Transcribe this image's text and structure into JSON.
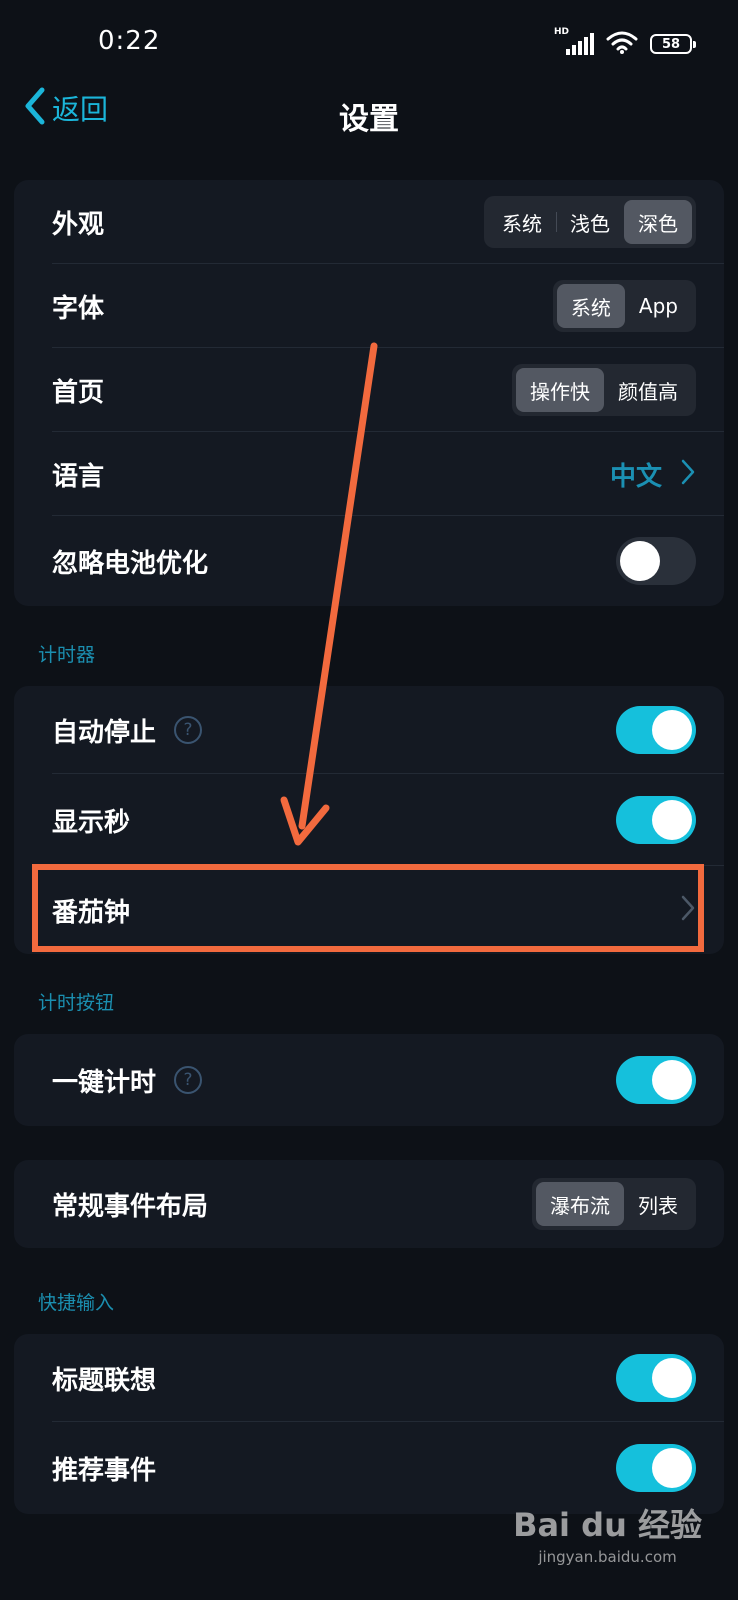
{
  "status_bar": {
    "time": "0:22",
    "network_badge": "HD",
    "battery_level": "58"
  },
  "header": {
    "back_label": "返回",
    "title": "设置"
  },
  "general": {
    "appearance": {
      "label": "外观",
      "options": [
        "系统",
        "浅色",
        "深色"
      ],
      "selected": "深色"
    },
    "font": {
      "label": "字体",
      "options": [
        "系统",
        "App"
      ],
      "selected": "系统"
    },
    "homepage": {
      "label": "首页",
      "options": [
        "操作快",
        "颜值高"
      ],
      "selected": "操作快"
    },
    "language": {
      "label": "语言",
      "value": "中文"
    },
    "battery_opt": {
      "label": "忽略电池优化",
      "enabled": false
    }
  },
  "timer_section": {
    "header": "计时器",
    "auto_stop": {
      "label": "自动停止",
      "enabled": true
    },
    "show_seconds": {
      "label": "显示秒",
      "enabled": true
    },
    "pomodoro": {
      "label": "番茄钟"
    }
  },
  "timer_button_section": {
    "header": "计时按钮",
    "one_tap": {
      "label": "一键计时",
      "enabled": true
    }
  },
  "layout": {
    "label": "常规事件布局",
    "options": [
      "瀑布流",
      "列表"
    ],
    "selected": "瀑布流"
  },
  "quick_input_section": {
    "header": "快捷输入",
    "title_suggest": {
      "label": "标题联想",
      "enabled": true
    },
    "recommend_events": {
      "label": "推荐事件",
      "enabled": true
    }
  },
  "watermark": {
    "logo": "Bai du 经验",
    "domain": "jingyan.baidu.com"
  },
  "colors": {
    "accent": "#15c0dc",
    "section_header": "#1b8fb0",
    "annotation": "#f26a3e",
    "background": "#0d1117"
  }
}
